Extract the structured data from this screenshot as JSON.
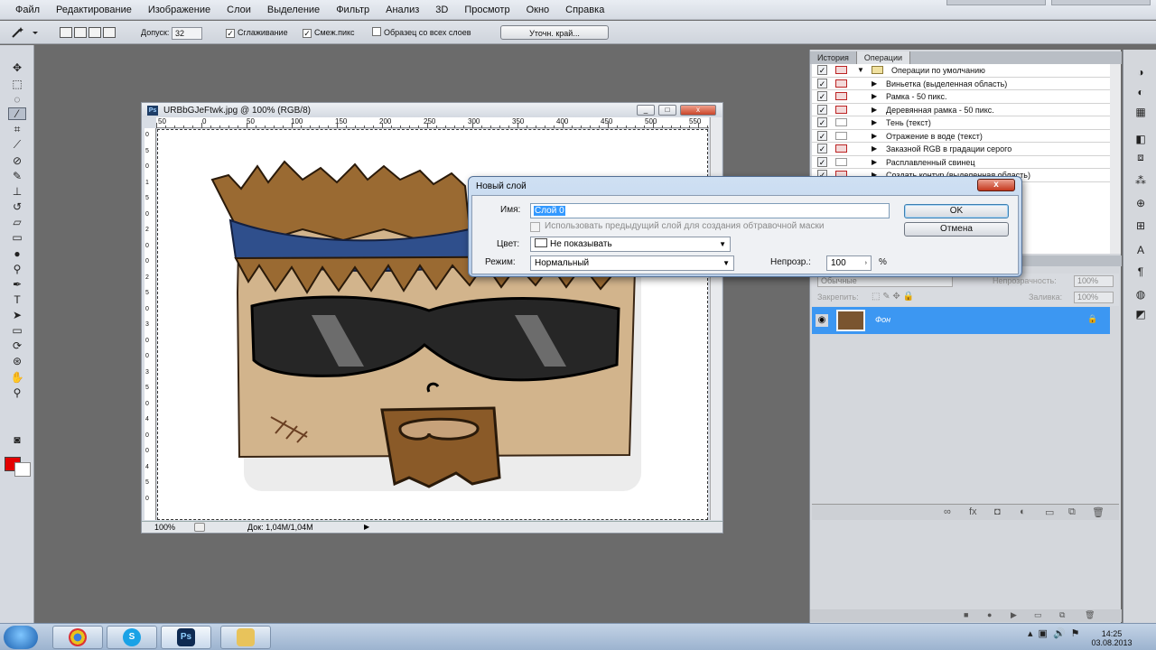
{
  "menu": [
    "Файл",
    "Редактирование",
    "Изображение",
    "Слои",
    "Выделение",
    "Фильтр",
    "Анализ",
    "3D",
    "Просмотр",
    "Окно",
    "Справка"
  ],
  "options": {
    "tolerance_label": "Допуск:",
    "tolerance_value": "32",
    "antialias_label": "Сглаживание",
    "contiguous_label": "Смеж.пикс",
    "sample_all_label": "Образец со всех слоев",
    "refine_edge_label": "Уточн. край..."
  },
  "document": {
    "title": "URBbGJeFtwk.jpg @ 100% (RGB/8)",
    "ps_badge": "Ps",
    "ruler_top": [
      "50",
      "0",
      "50",
      "100",
      "150",
      "200",
      "250",
      "300",
      "350",
      "400",
      "450",
      "500",
      "550"
    ],
    "ruler_left": [
      "0",
      "5",
      "0",
      "1",
      "5",
      "0",
      "2",
      "0",
      "0",
      "2",
      "5",
      "0",
      "3",
      "0",
      "0",
      "3",
      "5",
      "0",
      "4",
      "0",
      "0",
      "4",
      "5",
      "0"
    ],
    "zoom": "100%",
    "doc_size": "Док: 1,04M/1,04M"
  },
  "panels": {
    "tabs": [
      "История",
      "Операции"
    ],
    "actions_root": "Операции по умолчанию",
    "actions": [
      "Виньетка (выделенная область)",
      "Рамка - 50 пикс.",
      "Деревянная рамка - 50 пикс.",
      "Тень (текст)",
      "Отражение в воде (текст)",
      "Заказной RGB в градации серого",
      "Расплавленный свинец",
      "Создать контур (выделенная область)"
    ],
    "blend_mode": "Обычные",
    "opacity_label": "Непрозрачность:",
    "opacity_value": "100%",
    "lock_label": "Закрепить:",
    "fill_label": "Заливка:",
    "fill_value": "100%",
    "layer_name": "Фон"
  },
  "dialog": {
    "title": "Новый слой",
    "name_label": "Имя:",
    "name_value": "Слой 0",
    "clip_label": "Использовать предыдущий слой для создания обтравочной маски",
    "color_label": "Цвет:",
    "color_value": "Не показывать",
    "mode_label": "Режим:",
    "mode_value": "Нормальный",
    "opacity_label": "Непрозр.:",
    "opacity_value": "100",
    "percent": "%",
    "ok_label": "OK",
    "cancel_label": "Отмена",
    "close_glyph": "x"
  },
  "taskbar": {
    "time": "14:25",
    "date": "03.08.2013",
    "ps_label": "Ps"
  }
}
